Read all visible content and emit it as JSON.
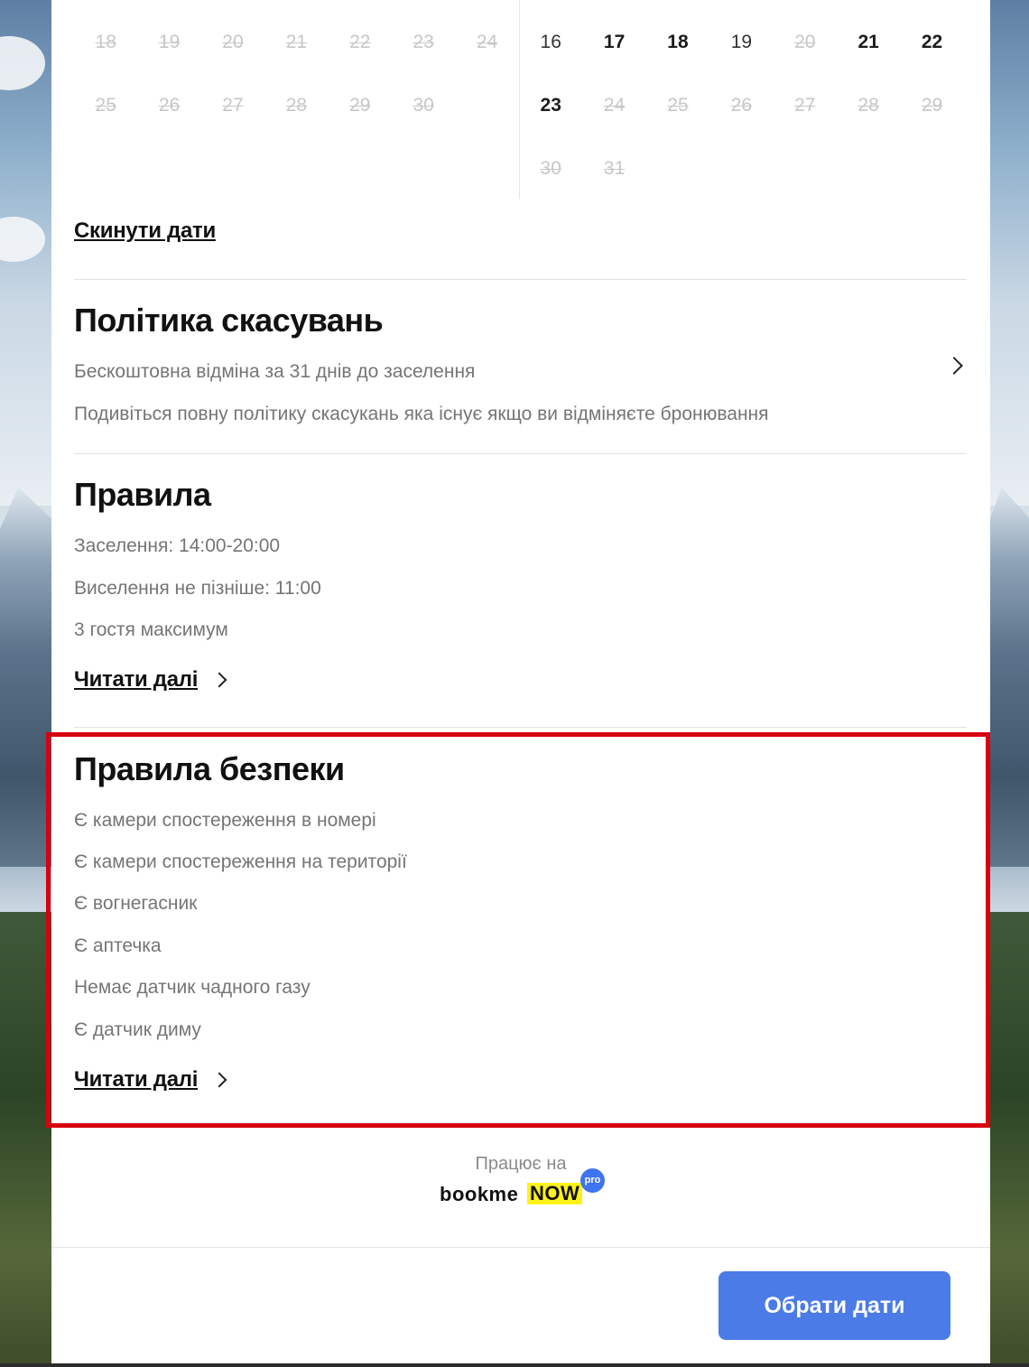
{
  "calendar": {
    "left_month_days": [
      {
        "d": "18",
        "state": "disabled"
      },
      {
        "d": "19",
        "state": "disabled"
      },
      {
        "d": "20",
        "state": "disabled"
      },
      {
        "d": "21",
        "state": "disabled"
      },
      {
        "d": "22",
        "state": "disabled"
      },
      {
        "d": "23",
        "state": "disabled"
      },
      {
        "d": "24",
        "state": "disabled"
      },
      {
        "d": "25",
        "state": "disabled"
      },
      {
        "d": "26",
        "state": "disabled"
      },
      {
        "d": "27",
        "state": "disabled"
      },
      {
        "d": "28",
        "state": "disabled"
      },
      {
        "d": "29",
        "state": "disabled"
      },
      {
        "d": "30",
        "state": "disabled"
      }
    ],
    "right_month_days": [
      {
        "d": "16",
        "state": "avail"
      },
      {
        "d": "17",
        "state": "bold"
      },
      {
        "d": "18",
        "state": "bold"
      },
      {
        "d": "19",
        "state": "avail"
      },
      {
        "d": "20",
        "state": "disabled"
      },
      {
        "d": "21",
        "state": "bold"
      },
      {
        "d": "22",
        "state": "bold"
      },
      {
        "d": "23",
        "state": "bold"
      },
      {
        "d": "24",
        "state": "disabled"
      },
      {
        "d": "25",
        "state": "disabled"
      },
      {
        "d": "26",
        "state": "disabled"
      },
      {
        "d": "27",
        "state": "disabled"
      },
      {
        "d": "28",
        "state": "disabled"
      },
      {
        "d": "29",
        "state": "disabled"
      },
      {
        "d": "30",
        "state": "disabled"
      },
      {
        "d": "31",
        "state": "disabled"
      }
    ],
    "reset_label": "Скинути дати"
  },
  "cancellation": {
    "title": "Політика скасувань",
    "line1": "Бескоштовна відміна за 31 днів до заселення",
    "line2": "Подивіться повну політику скасукань яка існує якщо ви відміняєте бронювання",
    "chevron_icon": "chevron-right-icon"
  },
  "rules": {
    "title": "Правила",
    "items": [
      "Заселення: 14:00-20:00",
      "Виселення не пізніше: 11:00",
      "3 гостя максимум"
    ],
    "read_more": "Читати далі"
  },
  "safety": {
    "title": "Правила безпеки",
    "items": [
      "Є камери спостереження в номері",
      "Є камери спостереження на території",
      "Є вогнегасник",
      "Є аптечка",
      "Немає датчик чадного газу",
      "Є датчик диму"
    ],
    "read_more": "Читати далі",
    "highlight_color": "#d7000f"
  },
  "footer": {
    "powered_by": "Працює на",
    "logo_main": "bookme",
    "logo_now": "NOW",
    "logo_pro": "pro",
    "cta_label": "Обрати дати",
    "cta_color": "#4b7be6"
  }
}
